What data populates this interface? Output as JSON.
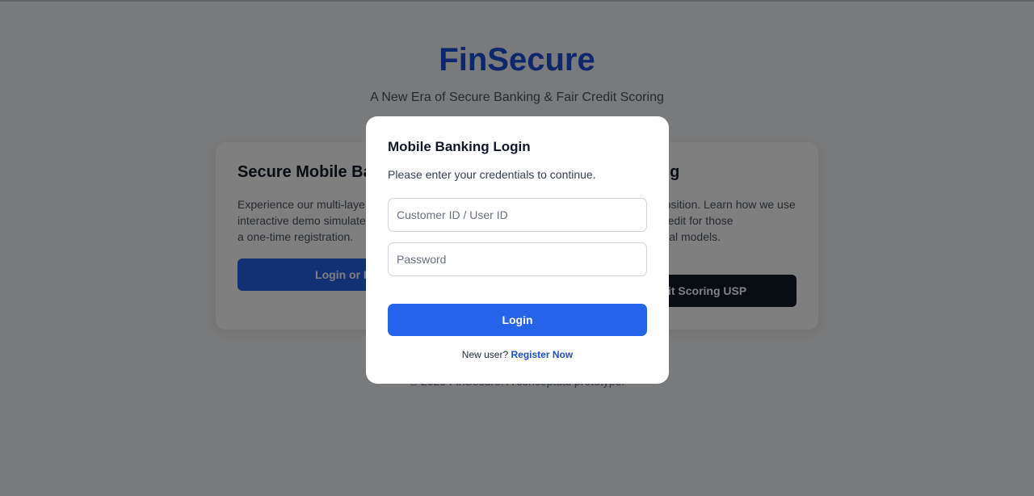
{
  "brand": {
    "name": "FinSecure",
    "tagline": "A New Era of Secure Banking & Fair Credit Scoring"
  },
  "cards": {
    "left": {
      "title": "Secure Mobile Banking",
      "body": "Experience our multi-layered security. This interactive demo simulates our login process and a one-time registration.",
      "cta": "Login or Register"
    },
    "right": {
      "title": "AI Credit Scoring",
      "body": "Our unique selling proposition. Learn how we use real-time, explainable credit for those underserved by traditional models.",
      "cta": "Explore Credit Scoring USP"
    }
  },
  "footer": {
    "text": "© 2025 FinSecure. A conceptual prototype."
  },
  "modal": {
    "title": "Mobile Banking Login",
    "subtitle": "Please enter your credentials to continue.",
    "user_placeholder": "Customer ID / User ID",
    "password_placeholder": "Password",
    "login_label": "Login",
    "new_user_text": "New user?",
    "register_label": "Register Now"
  }
}
